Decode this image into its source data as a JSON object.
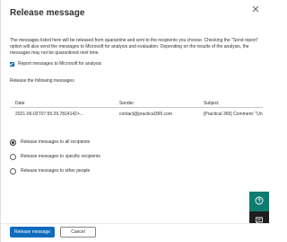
{
  "dialog": {
    "title": "Release message",
    "close_icon": "close-icon"
  },
  "description": "The messages listed here will be released from quarantine and sent to the recipients you choose. Checking the \"Send report\" option will also send the messages to Microsoft for analysis and evaluation. Depending on the results of the analysis, the messages may not be quarantined next time.",
  "report_checkbox": {
    "label": "Report messages to Microsoft for analysis",
    "checked": true
  },
  "messages_section": {
    "label": "Release the following messages"
  },
  "table": {
    "columns": [
      "Date",
      "Sender",
      "Subject"
    ],
    "rows": [
      [
        "2021-06-02T07:55:29.7814142+...",
        "contact@practical365.com",
        "[Practical 365] Comment: \"Unde..."
      ]
    ]
  },
  "release_options": {
    "selected": 0,
    "items": [
      "Release messages to all recipients",
      "Release messages to specific recipients",
      "Release messages to other people"
    ]
  },
  "fabs": {
    "help_icon": "help-icon",
    "chat_icon": "chat-icon",
    "help_color": "#0f7c72",
    "chat_color": "#1f1f1f"
  },
  "footer": {
    "primary_label": "Release message",
    "secondary_label": "Cancel"
  },
  "colors": {
    "accent": "#0f6cbd"
  }
}
